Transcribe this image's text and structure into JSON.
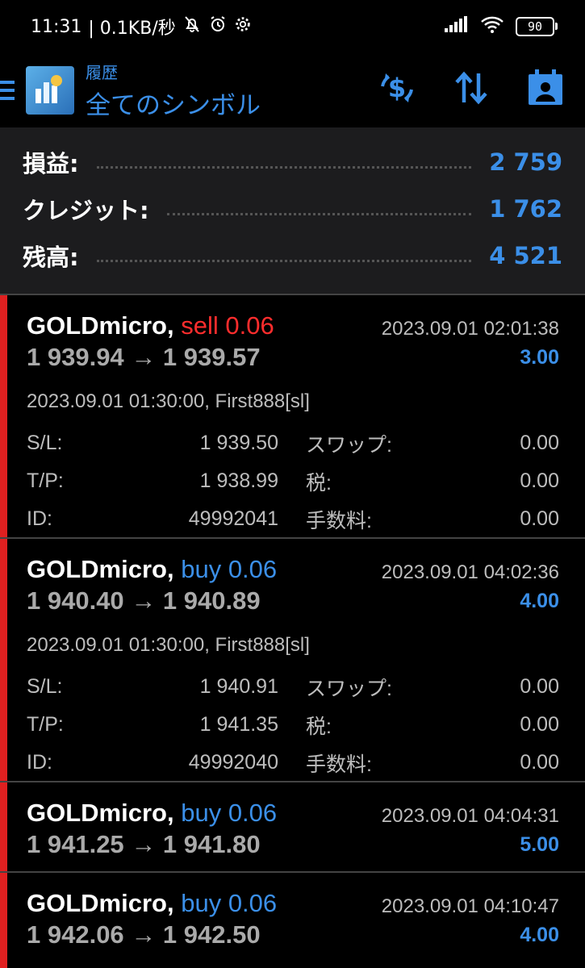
{
  "status_bar": {
    "time": "11:31",
    "speed": "| 0.1KB/秒",
    "battery": "90",
    "icons": [
      "mute-bell-icon",
      "alarm-icon",
      "gear-icon",
      "signal-icon",
      "wifi-icon",
      "battery-icon"
    ]
  },
  "header": {
    "subtitle": "履歴",
    "title": "全てのシンボル",
    "toolbar": [
      "currency-exchange-icon",
      "sort-icon",
      "calendar-period-icon"
    ]
  },
  "colors": {
    "accent": "#3b8fe8",
    "sell": "#ff2d2d",
    "marker": "#e02020"
  },
  "summary": [
    {
      "label": "損益:",
      "value": "2 759"
    },
    {
      "label": "クレジット:",
      "value": "1 762"
    },
    {
      "label": "残高:",
      "value": "4 521"
    }
  ],
  "deals": [
    {
      "symbol": "GOLDmicro,",
      "type": "sell 0.06",
      "side": "sell",
      "close_time": "2023.09.01 02:01:38",
      "prices": "1 939.94 → 1 939.57",
      "profit": "3.00",
      "expanded": true,
      "open_info": "2023.09.01 01:30:00, First888[sl]",
      "sl_label": "S/L:",
      "sl": "1 939.50",
      "swap_label": "スワップ:",
      "swap": "0.00",
      "tp_label": "T/P:",
      "tp": "1 938.99",
      "tax_label": "税:",
      "tax": "0.00",
      "id_label": "ID:",
      "id": "49992041",
      "fee_label": "手数料:",
      "fee": "0.00"
    },
    {
      "symbol": "GOLDmicro,",
      "type": "buy 0.06",
      "side": "buy",
      "close_time": "2023.09.01 04:02:36",
      "prices": "1 940.40 → 1 940.89",
      "profit": "4.00",
      "expanded": true,
      "open_info": "2023.09.01 01:30:00, First888[sl]",
      "sl_label": "S/L:",
      "sl": "1 940.91",
      "swap_label": "スワップ:",
      "swap": "0.00",
      "tp_label": "T/P:",
      "tp": "1 941.35",
      "tax_label": "税:",
      "tax": "0.00",
      "id_label": "ID:",
      "id": "49992040",
      "fee_label": "手数料:",
      "fee": "0.00"
    },
    {
      "symbol": "GOLDmicro,",
      "type": "buy 0.06",
      "side": "buy",
      "close_time": "2023.09.01 04:04:31",
      "prices": "1 941.25 → 1 941.80",
      "profit": "5.00",
      "expanded": false
    },
    {
      "symbol": "GOLDmicro,",
      "type": "buy 0.06",
      "side": "buy",
      "close_time": "2023.09.01 04:10:47",
      "prices": "1 942.06 → 1 942.50",
      "profit": "4.00",
      "expanded": false
    }
  ]
}
